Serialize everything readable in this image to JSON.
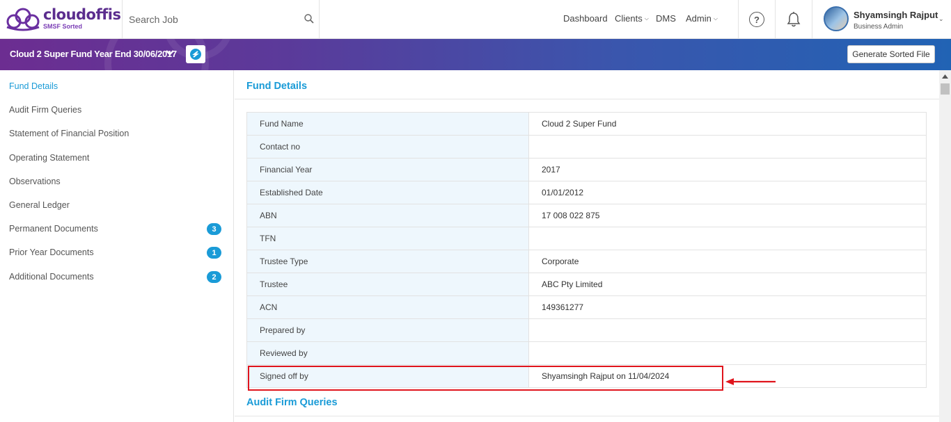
{
  "brand": {
    "name": "cloudoffis",
    "tagline": "SMSF Sorted"
  },
  "search": {
    "placeholder": "Search Job"
  },
  "nav": {
    "dashboard": "Dashboard",
    "clients": "Clients",
    "dms": "DMS",
    "admin": "Admin"
  },
  "user": {
    "name": "Shyamsingh Rajput",
    "role": "Business Admin"
  },
  "banner": {
    "job_title": "Cloud 2 Super Fund Year End 30/06/2017",
    "generate_button": "Generate Sorted File"
  },
  "sidebar": {
    "items": [
      {
        "label": "Fund Details",
        "active": true
      },
      {
        "label": "Audit Firm Queries"
      },
      {
        "label": "Statement of Financial Position"
      },
      {
        "label": "Operating Statement"
      },
      {
        "label": "Observations"
      },
      {
        "label": "General Ledger"
      },
      {
        "label": "Permanent Documents",
        "badge": "3"
      },
      {
        "label": "Prior Year Documents",
        "badge": "1"
      },
      {
        "label": "Additional Documents",
        "badge": "2"
      }
    ]
  },
  "main": {
    "fund_details_title": "Fund Details",
    "audit_queries_title": "Audit Firm Queries",
    "rows": [
      {
        "label": "Fund Name",
        "value": "Cloud 2 Super Fund"
      },
      {
        "label": "Contact no",
        "value": ""
      },
      {
        "label": "Financial Year",
        "value": "2017"
      },
      {
        "label": "Established Date",
        "value": "01/01/2012"
      },
      {
        "label": "ABN",
        "value": "17 008 022 875"
      },
      {
        "label": "TFN",
        "value": ""
      },
      {
        "label": "Trustee Type",
        "value": "Corporate"
      },
      {
        "label": "Trustee",
        "value": "ABC Pty Limited"
      },
      {
        "label": "ACN",
        "value": "149361277"
      },
      {
        "label": "Prepared by",
        "value": ""
      },
      {
        "label": "Reviewed by",
        "value": ""
      },
      {
        "label": "Signed off by",
        "value": "Shyamsingh Rajput on 11/04/2024"
      }
    ]
  },
  "colors": {
    "accent": "#1a9bd7",
    "brand_purple": "#5b2d8e",
    "banner_start": "#6c2d91",
    "banner_end": "#2163b4",
    "highlight": "#e0141c"
  }
}
